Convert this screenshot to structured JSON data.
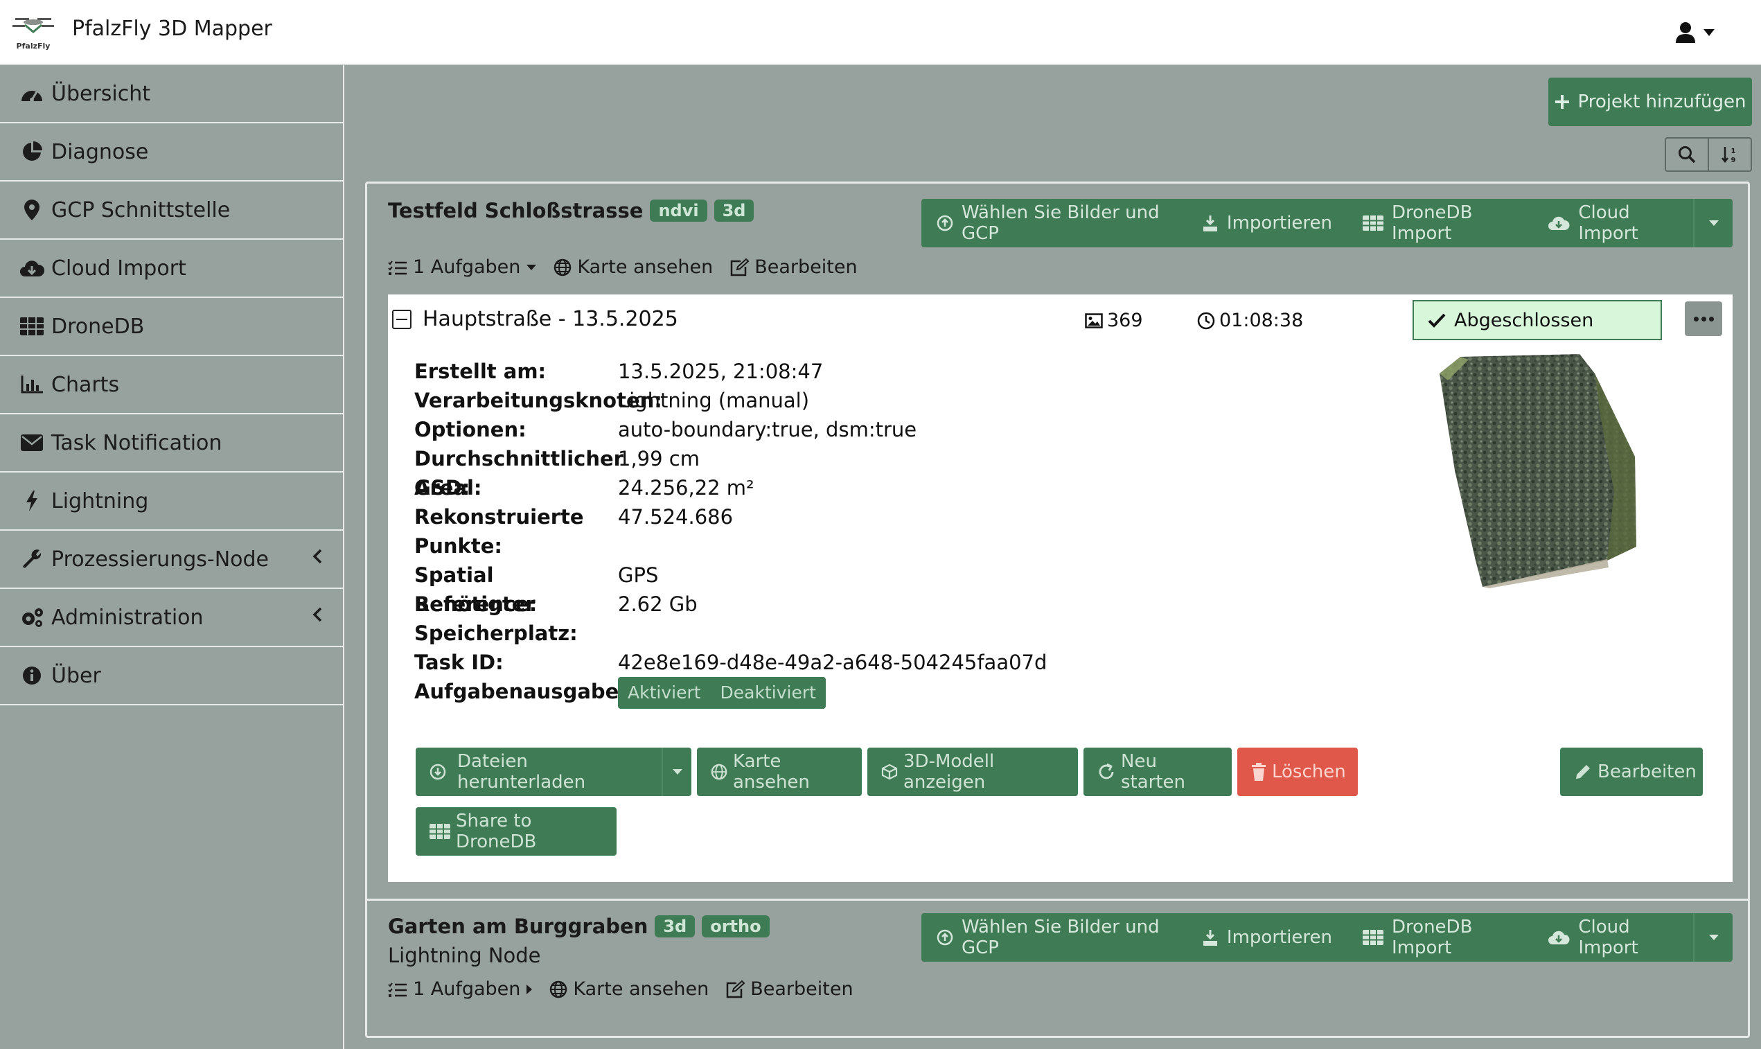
{
  "header": {
    "app_title": "PfalzFly 3D Mapper",
    "logo_text": "PfalzFly"
  },
  "sidebar": {
    "items": [
      {
        "label": "Übersicht",
        "icon": "dashboard-icon"
      },
      {
        "label": "Diagnose",
        "icon": "pie-chart-icon"
      },
      {
        "label": "GCP Schnittstelle",
        "icon": "map-marker-icon"
      },
      {
        "label": "Cloud Import",
        "icon": "cloud-download-icon"
      },
      {
        "label": "DroneDB",
        "icon": "database-icon"
      },
      {
        "label": "Charts",
        "icon": "bar-chart-icon"
      },
      {
        "label": "Task Notification",
        "icon": "envelope-icon"
      },
      {
        "label": "Lightning",
        "icon": "bolt-icon"
      },
      {
        "label": "Prozessierungs-Node",
        "icon": "wrench-icon"
      },
      {
        "label": "Administration",
        "icon": "gears-icon"
      },
      {
        "label": "Über",
        "icon": "info-icon"
      }
    ]
  },
  "toolbar": {
    "add_project_label": "Projekt hinzufügen"
  },
  "project_buttons": {
    "select_images": "Wählen Sie Bilder und GCP",
    "import": "Importieren",
    "dronedb_import": "DroneDB Import",
    "cloud_import": "Cloud Import"
  },
  "projects": [
    {
      "name": "Testfeld Schloßstrasse",
      "tags": [
        "ndvi",
        "3d"
      ],
      "tasks_link": "1 Aufgaben",
      "view_map": "Karte ansehen",
      "edit": "Bearbeiten"
    },
    {
      "name": "Garten am Burggraben",
      "tags": [
        "3d",
        "ortho"
      ],
      "subtitle": "Lightning Node",
      "tasks_link": "1 Aufgaben",
      "view_map": "Karte ansehen",
      "edit": "Bearbeiten"
    }
  ],
  "task": {
    "name": "Hauptstraße - 13.5.2025",
    "image_count": "369",
    "duration": "01:08:38",
    "status": "Abgeschlossen",
    "details": [
      {
        "label": "Erstellt am:",
        "value": "13.5.2025, 21:08:47"
      },
      {
        "label": "Verarbeitungsknoten:",
        "value": "Lightning (manual)"
      },
      {
        "label": "Optionen:",
        "value": "auto-boundary:true, dsm:true"
      },
      {
        "label": "Durchschnittlicher GSD:",
        "value": "1,99 cm"
      },
      {
        "label": "Areal:",
        "value": "24.256,22 m²"
      },
      {
        "label": "Rekonstruierte Punkte:",
        "value": "47.524.686"
      },
      {
        "label": "Spatial Reference:",
        "value": "GPS"
      },
      {
        "label": "Benötigter Speicherplatz:",
        "value": "2.62 Gb"
      },
      {
        "label": "Task ID:",
        "value": "42e8e169-d48e-49a2-a648-504245faa07d"
      },
      {
        "label": "Aufgabenausgabe:",
        "value": ""
      }
    ],
    "output_toggle": {
      "on": "Aktiviert",
      "off": "Deaktiviert"
    },
    "actions": {
      "download": "Dateien herunterladen",
      "view_map": "Karte ansehen",
      "view_3d": "3D-Modell anzeigen",
      "restart": "Neu starten",
      "delete": "Löschen",
      "edit": "Bearbeiten",
      "share": "Share to DroneDB"
    }
  },
  "colors": {
    "primary": "#3f7b54",
    "danger": "#e0584a",
    "background": "#97a19d",
    "status_bg": "#d8f6da"
  }
}
